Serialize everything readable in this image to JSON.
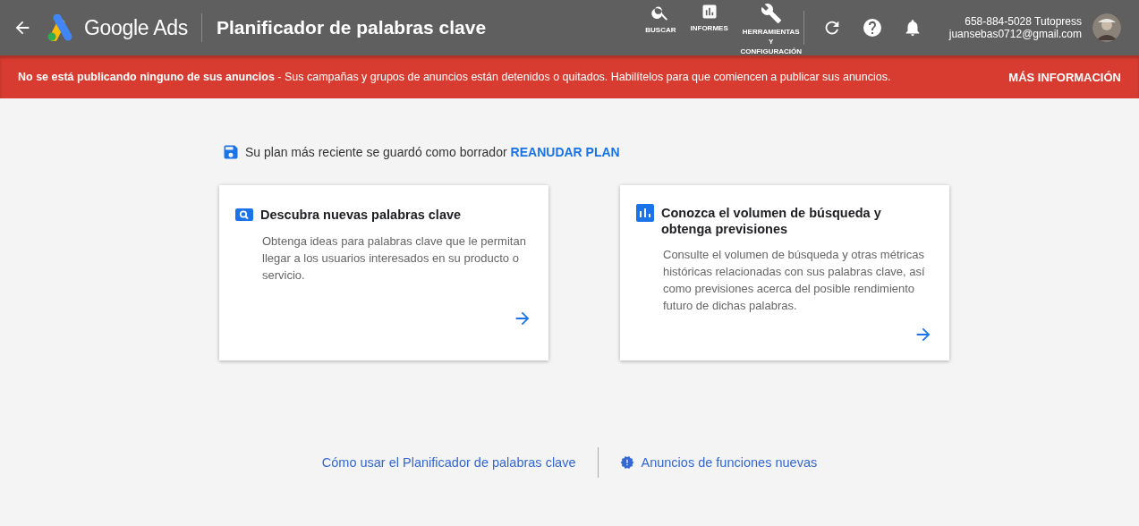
{
  "header": {
    "product": "Google Ads",
    "title": "Planificador de palabras clave",
    "nav": [
      {
        "label": "BUSCAR"
      },
      {
        "label": "INFORMES"
      },
      {
        "label": "HERRAMIENTAS Y CONFIGURACIÓN"
      }
    ],
    "account": {
      "id": "658-884-5028 Tutopress",
      "email": "juansebas0712@gmail.com"
    }
  },
  "alert": {
    "message": "**No se está publicando ninguno de sus anuncios** - Sus campañas y grupos de anuncios están detenidos o quitados. Habilítelos para que comiencen a publicar sus anuncios.",
    "action": "MÁS INFORMACIÓN"
  },
  "draft": {
    "text": "Su plan más reciente se guardó como borrador",
    "link": "REANUDAR PLAN"
  },
  "cards": [
    {
      "title": "Descubra nuevas palabras clave",
      "description": "Obtenga ideas para palabras clave que le permitan llegar a los usuarios interesados en su producto o servicio."
    },
    {
      "title": "Conozca el volumen de búsqueda y obtenga previsiones",
      "description": "Consulte el volumen de búsqueda y otras métricas históricas relacionadas con sus palabras clave, así como previsiones acerca del posible rendimiento futuro de dichas palabras."
    }
  ],
  "footer_links": [
    {
      "label": "Cómo usar el Planificador de palabras clave"
    },
    {
      "label": "Anuncios de funciones nuevas"
    }
  ]
}
